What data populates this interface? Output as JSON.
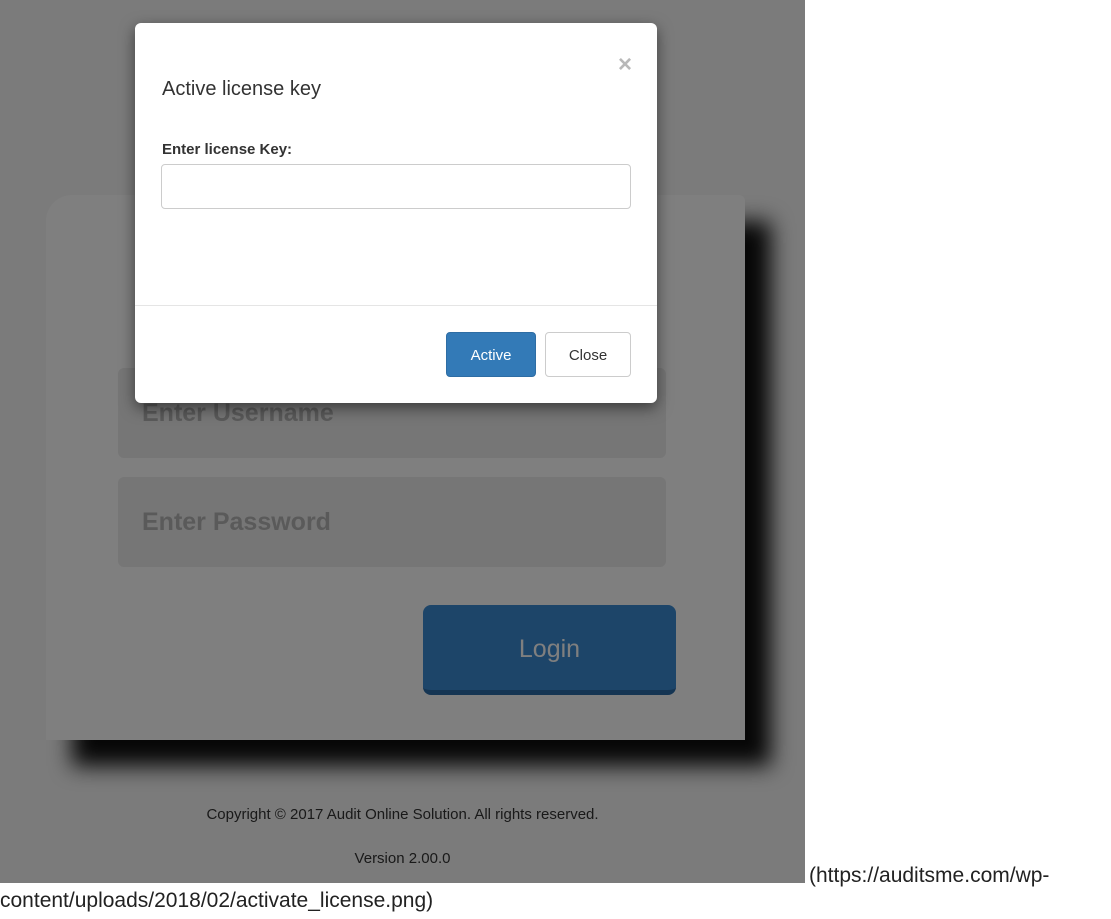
{
  "background_page": {
    "username_placeholder": "Enter Username",
    "password_placeholder": "Enter Password",
    "login_label": "Login",
    "copyright": "Copyright © 2017 Audit Online Solution. All rights reserved.",
    "version": "Version 2.00.0"
  },
  "modal": {
    "title": "Active license key",
    "close_icon": "×",
    "field_label": "Enter license Key:",
    "input_value": "",
    "active_label": "Active",
    "close_label": "Close"
  },
  "caption": {
    "line1": "(https://auditsme.com/wp-",
    "line2": "content/uploads/2018/02/activate_license.png)"
  },
  "colors": {
    "primary": "#337ab7",
    "backdrop": "rgba(0,0,0,0.5)"
  }
}
